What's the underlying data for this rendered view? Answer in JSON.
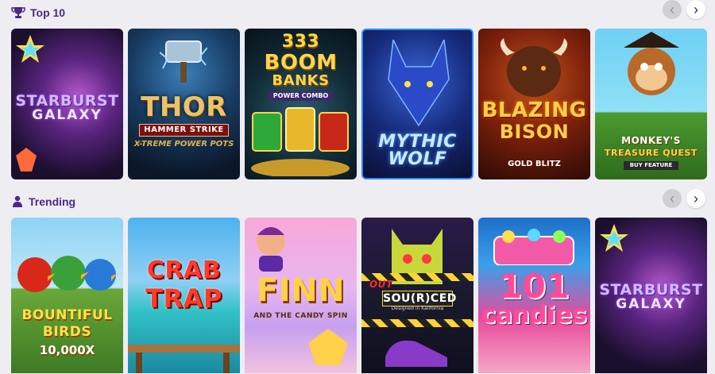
{
  "sections": [
    {
      "title": "Top 10",
      "icon": "trophy-icon",
      "nav": {
        "prev": "‹",
        "next": "›"
      },
      "tiles": [
        {
          "title": "STARBURST",
          "subtitle": "GALAXY"
        },
        {
          "title": "THOR",
          "subtitle": "HAMMER STRIKE",
          "tag": "X-TREME POWER POTS"
        },
        {
          "title": "BOOM",
          "number": "333",
          "subtitle": "BANKS",
          "tag": "POWER COMBO"
        },
        {
          "title": "MYTHIC WOLF"
        },
        {
          "title": "BLAZING",
          "subtitle": "BISON",
          "tag": "GOLD BLITZ"
        },
        {
          "title": "MONKEY'S",
          "subtitle": "TREASURE QUEST",
          "tag": "BUY FEATURE"
        }
      ]
    },
    {
      "title": "Trending",
      "icon": "person-icon",
      "nav": {
        "prev": "‹",
        "next": "›"
      },
      "tiles": [
        {
          "title": "BOUNTIFUL",
          "subtitle": "BIRDS",
          "tag": "10,000X"
        },
        {
          "title": "CRAB",
          "subtitle": "TRAP"
        },
        {
          "title": "FINN",
          "subtitle": "AND THE CANDY SPIN"
        },
        {
          "title": "OUT",
          "subtitle": "SOU(R)CED",
          "tag": "Designed in Kalifornia"
        },
        {
          "title": "101",
          "subtitle": "candies"
        },
        {
          "title": "STARBURST",
          "subtitle": "GALAXY"
        }
      ]
    }
  ],
  "colors": {
    "heading": "#4a2a88",
    "background": "#eeedf2"
  }
}
